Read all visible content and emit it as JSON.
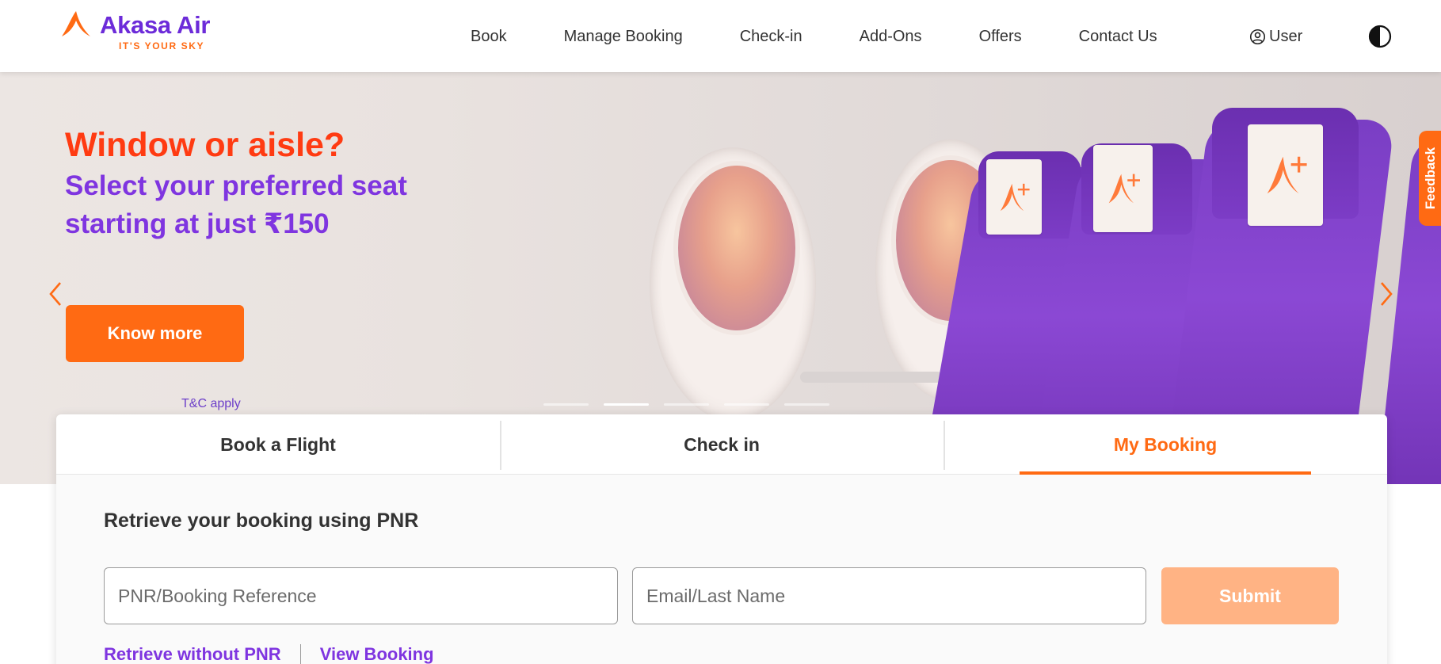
{
  "brand": {
    "name": "Akasa Air",
    "tagline": "IT'S YOUR SKY",
    "colors": {
      "primary": "#ff6a13",
      "secondary": "#7f35e0",
      "headline": "#ff3b12"
    }
  },
  "header": {
    "nav": [
      {
        "label": "Book"
      },
      {
        "label": "Manage Booking"
      },
      {
        "label": "Check-in"
      },
      {
        "label": "Add-Ons"
      },
      {
        "label": "Offers"
      },
      {
        "label": "Contact Us"
      }
    ],
    "user_label": "User",
    "user_icon": "user-circle-icon",
    "theme_icon": "contrast-icon"
  },
  "hero": {
    "title": "Window or aisle?",
    "subtitle": "Select your preferred seat starting at just ₹150",
    "cta_label": "Know more",
    "tc_label": "T&C apply",
    "feedback_label": "Feedback",
    "slides": {
      "count": 5,
      "active": 1
    },
    "prev_icon": "chevron-left-icon",
    "next_icon": "chevron-right-icon"
  },
  "booking": {
    "tabs": [
      {
        "label": "Book a Flight",
        "active": false
      },
      {
        "label": "Check in",
        "active": false
      },
      {
        "label": "My Booking",
        "active": true
      }
    ],
    "retrieve_title": "Retrieve your booking using PNR",
    "pnr_placeholder": "PNR/Booking Reference",
    "pnr_value": "",
    "email_placeholder": "Email/Last Name",
    "email_value": "",
    "submit_label": "Submit",
    "links": [
      {
        "label": "Retrieve without PNR"
      },
      {
        "label": "View Booking"
      }
    ]
  }
}
